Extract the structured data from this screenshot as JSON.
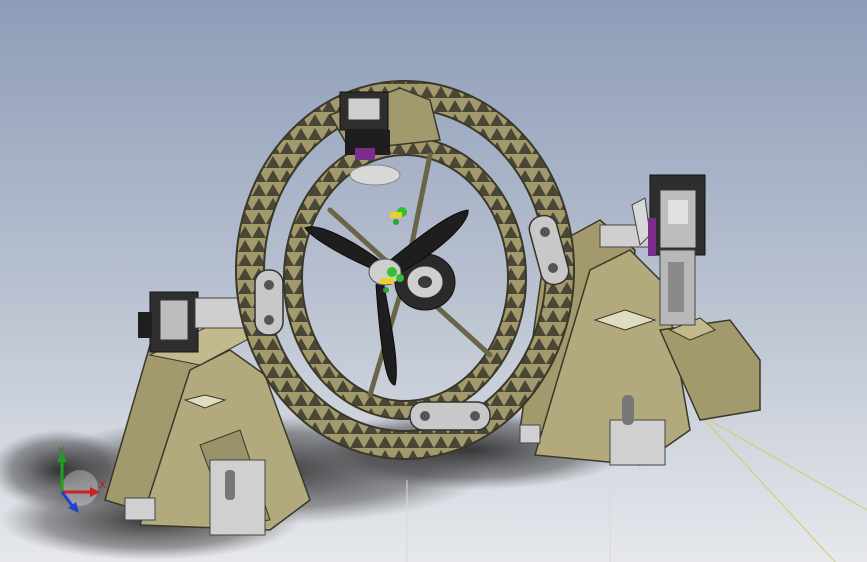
{
  "viewport": {
    "background_top": "#8d9cb8",
    "background_bottom": "#e6e8ec"
  },
  "model": {
    "frame_color": "#a29a6c",
    "bracket_color": "#bfbfbf",
    "motor_color": "#3a3a3a",
    "accent_color": "#7b2d8e",
    "propeller_color": "#1e1e1e"
  },
  "triad": {
    "x_label": "X",
    "y_label": "Y",
    "x_color": "#d02020",
    "y_color": "#20a020",
    "z_color": "#2040d0"
  }
}
